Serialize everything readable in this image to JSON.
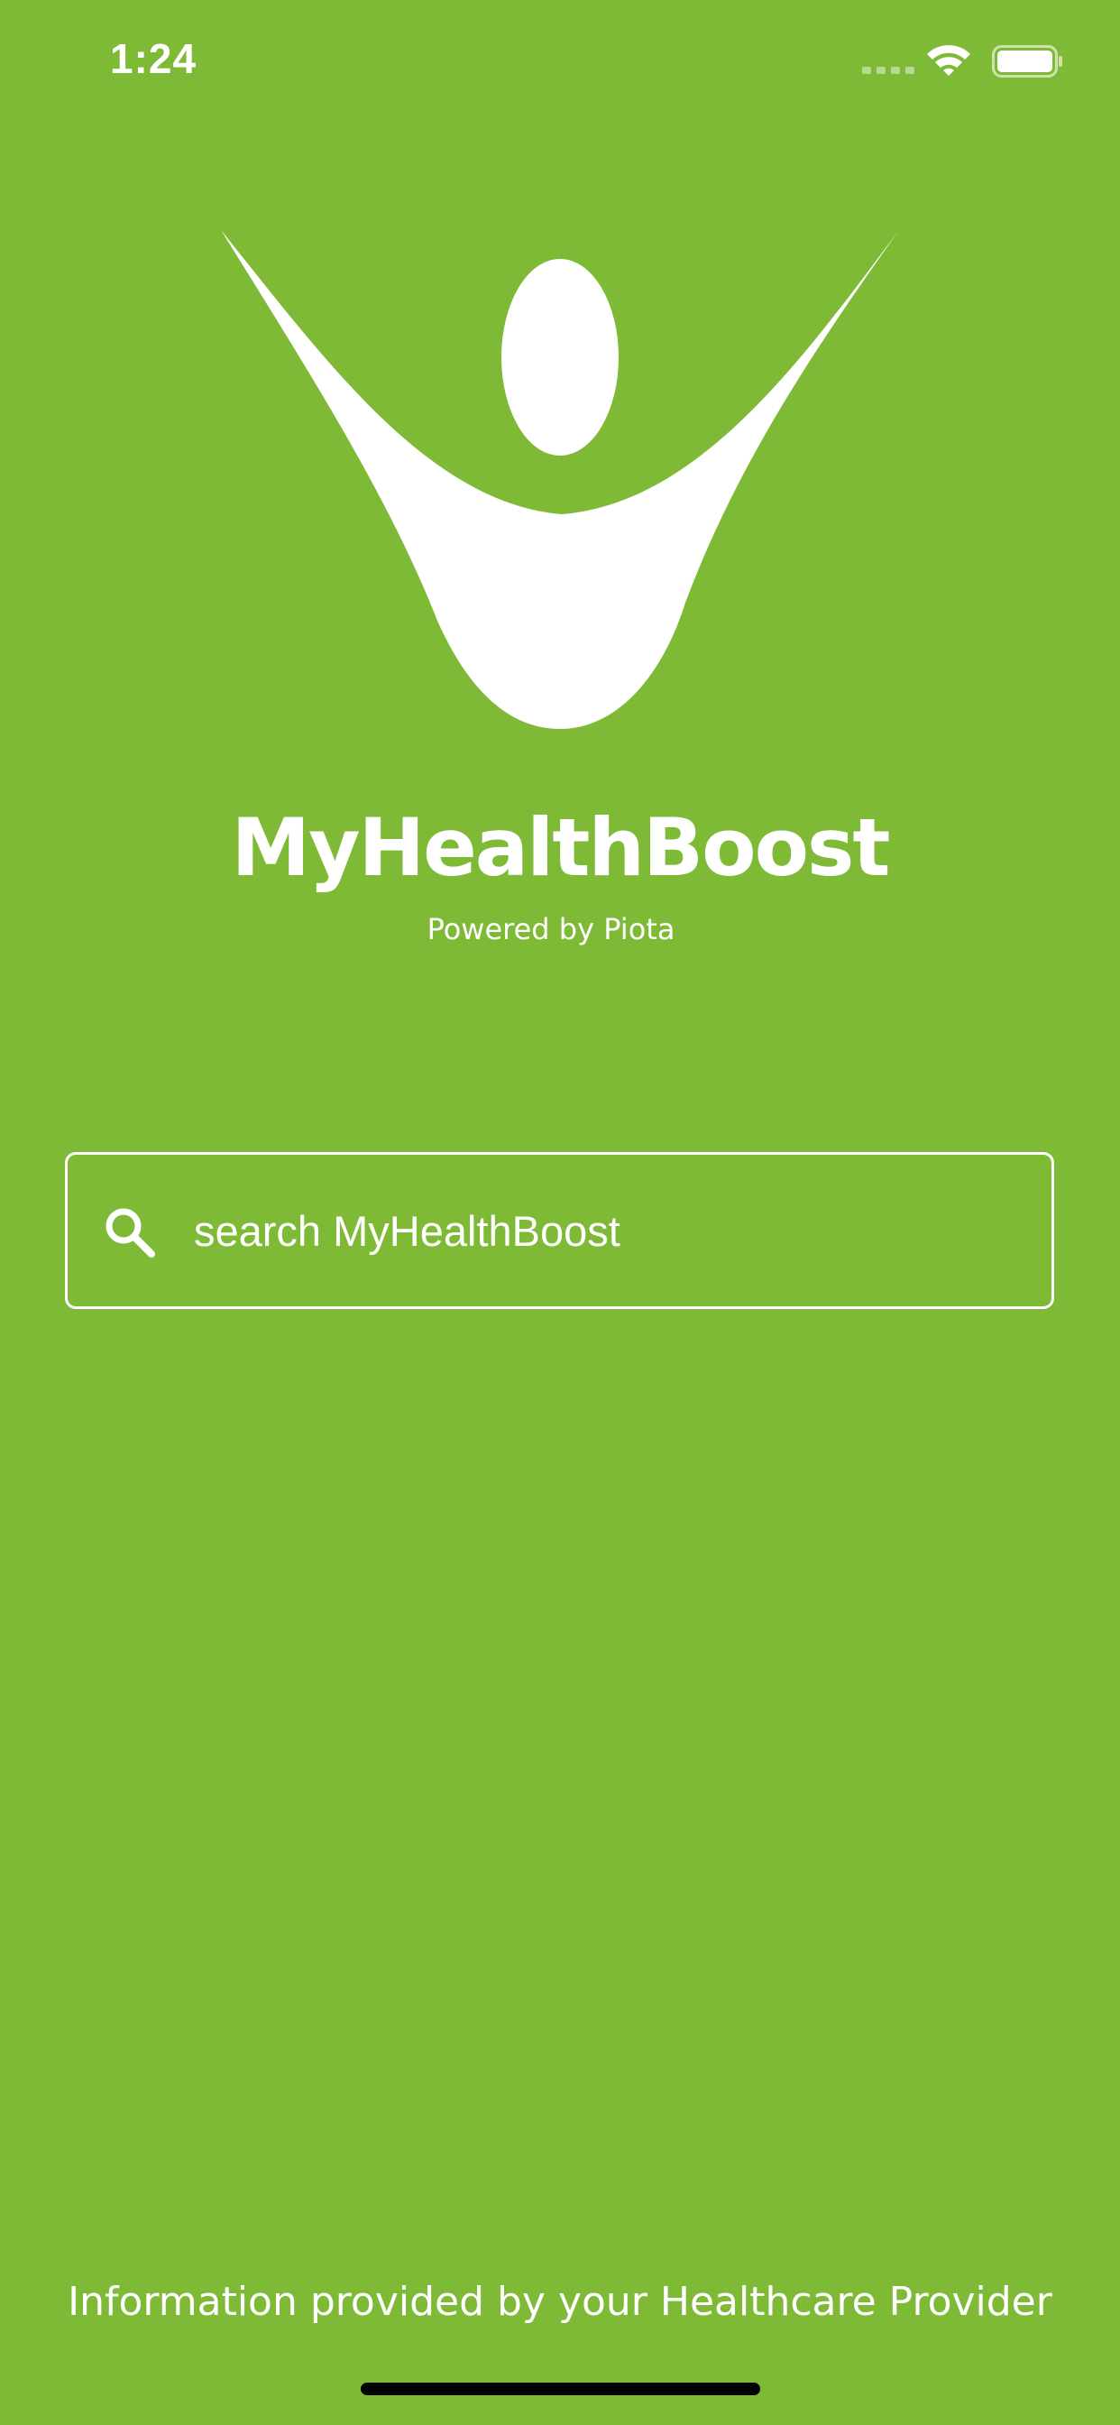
{
  "status_bar": {
    "time": "1:24",
    "icons": [
      "signal-dots-icon",
      "wifi-icon",
      "battery-icon"
    ]
  },
  "brand": {
    "logo_icon": "person-raising-arms-icon",
    "title": "MyHealthBoost",
    "subtitle": "Powered by Piota"
  },
  "search": {
    "icon": "search-icon",
    "placeholder": "search MyHealthBoost"
  },
  "footer": {
    "note": "Information provided by your Healthcare Provider"
  },
  "colors": {
    "background": "#7fba36",
    "foreground": "#ffffff"
  }
}
